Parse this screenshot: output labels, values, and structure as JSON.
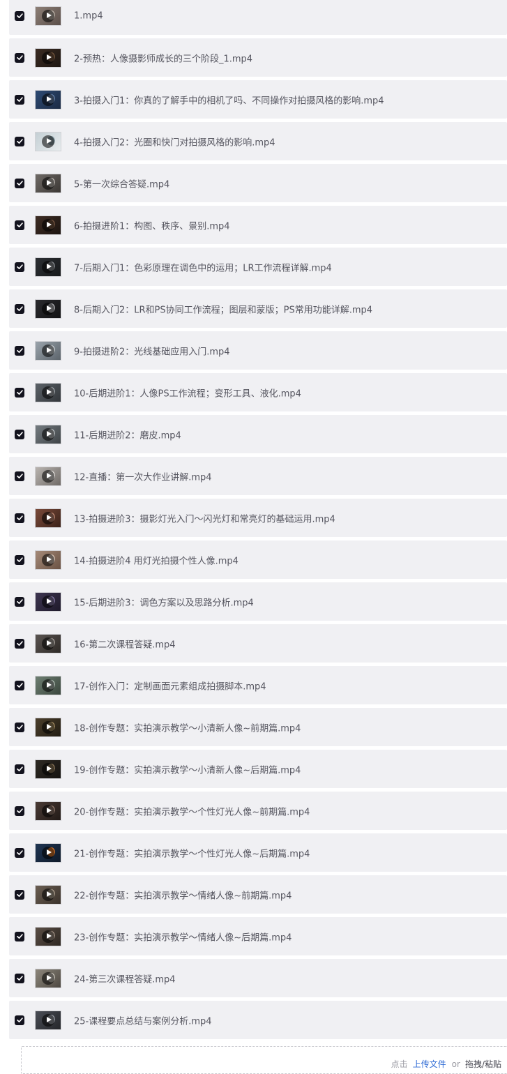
{
  "files": [
    {
      "name": "1.mp4",
      "thumb_colors": [
        "#8d7f76",
        "#c7bdb2",
        "#5b4f4a"
      ],
      "checked": true
    },
    {
      "name": "2-预热：人像摄影师成长的三个阶段_1.mp4",
      "thumb_colors": [
        "#3a2b22",
        "#7a5a40",
        "#1d1611"
      ],
      "checked": true
    },
    {
      "name": "3-拍摄入门1：你真的了解手中的相机了吗、不同操作对拍摄风格的影响.mp4",
      "thumb_colors": [
        "#2d4a73",
        "#6d8bb5",
        "#1c2b44"
      ],
      "checked": true
    },
    {
      "name": "4-拍摄入门2：光圈和快门对拍摄风格的影响.mp4",
      "thumb_colors": [
        "#c4cfd4",
        "#8fa4ad",
        "#e7ecee"
      ],
      "checked": true
    },
    {
      "name": "5-第一次综合答疑.mp4",
      "thumb_colors": [
        "#6f6a66",
        "#c9c3bd",
        "#3b3734"
      ],
      "checked": true
    },
    {
      "name": "6-拍摄进阶1：构图、秩序、景别.mp4",
      "thumb_colors": [
        "#3e2d24",
        "#7b5944",
        "#1c1410"
      ],
      "checked": true
    },
    {
      "name": "7-后期入门1：色彩原理在调色中的运用；LR工作流程详解.mp4",
      "thumb_colors": [
        "#2c2f33",
        "#8f9397",
        "#17191b"
      ],
      "checked": true
    },
    {
      "name": "8-后期入门2：LR和PS协同工作流程；图层和蒙版；PS常用功能详解.mp4",
      "thumb_colors": [
        "#2b2b2e",
        "#b9b9bd",
        "#121214"
      ],
      "checked": true
    },
    {
      "name": "9-拍摄进阶2：光线基础应用入门.mp4",
      "thumb_colors": [
        "#9aa3ab",
        "#d6dbdf",
        "#5c646b"
      ],
      "checked": true
    },
    {
      "name": "10-后期进阶1：人像PS工作流程；变形工具、液化.mp4",
      "thumb_colors": [
        "#5c6268",
        "#a8aeb3",
        "#32363a"
      ],
      "checked": true
    },
    {
      "name": "11-后期进阶2：磨皮.mp4",
      "thumb_colors": [
        "#747b80",
        "#c3c8cb",
        "#3f4447"
      ],
      "checked": true
    },
    {
      "name": "12-直播：第一次大作业讲解.mp4",
      "thumb_colors": [
        "#b9b4b0",
        "#ebe7e3",
        "#6f6a66"
      ],
      "checked": true
    },
    {
      "name": "13-拍摄进阶3：摄影灯光入门～闪光灯和常亮灯的基础运用.mp4",
      "thumb_colors": [
        "#7a4a3a",
        "#c98f78",
        "#3b2219"
      ],
      "checked": true
    },
    {
      "name": "14-拍摄进阶4 用灯光拍摄个性人像.mp4",
      "thumb_colors": [
        "#a58a78",
        "#e3cfc0",
        "#6a5244"
      ],
      "checked": true
    },
    {
      "name": "15-后期进阶3：调色方案以及思路分析.mp4",
      "thumb_colors": [
        "#3d3550",
        "#8d7fae",
        "#1f1a2b"
      ],
      "checked": true
    },
    {
      "name": "16-第二次课程答疑.mp4",
      "thumb_colors": [
        "#5a5450",
        "#b0a9a3",
        "#2e2a27"
      ],
      "checked": true
    },
    {
      "name": "17-创作入门：定制画面元素组成拍摄脚本.mp4",
      "thumb_colors": [
        "#6e7f72",
        "#b7c4ba",
        "#3a463d"
      ],
      "checked": true
    },
    {
      "name": "18-创作专题：实拍演示教学～小清新人像~前期篇.mp4",
      "thumb_colors": [
        "#4b3f2c",
        "#a78e63",
        "#221c12"
      ],
      "checked": true
    },
    {
      "name": "19-创作专题：实拍演示教学～小清新人像~后期篇.mp4",
      "thumb_colors": [
        "#2e2a24",
        "#8e7a5c",
        "#151310"
      ],
      "checked": true
    },
    {
      "name": "20-创作专题：实拍演示教学～个性灯光人像~前期篇.mp4",
      "thumb_colors": [
        "#4a3b35",
        "#9a7f72",
        "#221a17"
      ],
      "checked": true
    },
    {
      "name": "21-创作专题：实拍演示教学～个性灯光人像~后期篇.mp4",
      "thumb_colors": [
        "#1f3552",
        "#e07a2a",
        "#0f1a29"
      ],
      "checked": true
    },
    {
      "name": "22-创作专题：实拍演示教学～情绪人像~前期篇.mp4",
      "thumb_colors": [
        "#6b5e52",
        "#b7a896",
        "#3a322b"
      ],
      "checked": true
    },
    {
      "name": "23-创作专题：实拍演示教学～情绪人像~后期篇.mp4",
      "thumb_colors": [
        "#5a4e45",
        "#a8978a",
        "#2e2722"
      ],
      "checked": true
    },
    {
      "name": "24-第三次课程答疑.mp4",
      "thumb_colors": [
        "#8d877c",
        "#d3cdc2",
        "#4d4841"
      ],
      "checked": true
    },
    {
      "name": "25-课程要点总结与案例分析.mp4",
      "thumb_colors": [
        "#4a4d55",
        "#9ea2ab",
        "#25272b"
      ],
      "checked": true
    }
  ],
  "upload": {
    "prefix": "点击",
    "link": "上传文件",
    "or": "or",
    "alt": "拖拽/粘贴"
  },
  "colors": {
    "row_bg": "#f0f0f3",
    "checkbox": "#13131e",
    "link": "#2f6bd5"
  },
  "icons": {
    "checkbox": "checkmark-icon",
    "thumbnail_overlay": "play-icon"
  }
}
